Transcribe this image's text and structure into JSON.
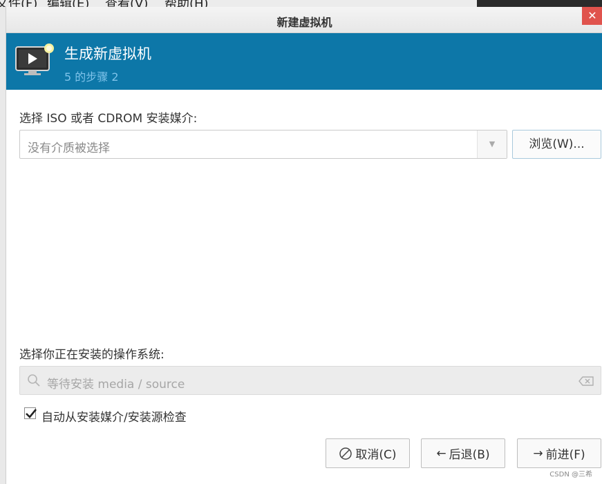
{
  "background_app": {
    "menu_items": [
      "文件(F)",
      "编辑(E)",
      "查看(V)",
      "帮助(H)"
    ]
  },
  "dialog": {
    "title": "新建虚拟机",
    "close_glyph": "✕"
  },
  "banner": {
    "heading": "生成新虚拟机",
    "step": "5 的步骤 2",
    "icon": "monitor-play-icon",
    "background_color": "#0d77a8"
  },
  "install_media": {
    "label": "选择 ISO 或者 CDROM 安装媒介:",
    "placeholder": "没有介质被选择",
    "browse_label": "浏览(W)..."
  },
  "os_selection": {
    "label": "选择你正在安装的操作系统:",
    "search_placeholder": "等待安装 media / source"
  },
  "auto_detect": {
    "label": "自动从安装媒介/安装源检查",
    "checked": true
  },
  "footer": {
    "cancel_label": "取消(C)",
    "back_label": "后退(B)",
    "forward_label": "前进(F)"
  },
  "watermark": "CSDN @三希"
}
